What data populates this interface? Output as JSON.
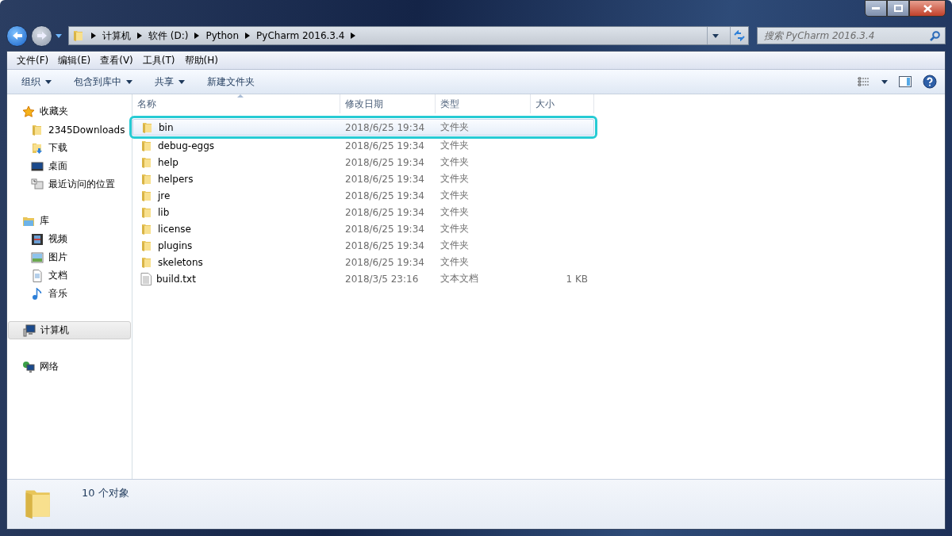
{
  "address_bar": {
    "crumbs": [
      "计算机",
      "软件 (D:)",
      "Python",
      "PyCharm 2016.3.4"
    ]
  },
  "search": {
    "placeholder": "搜索 PyCharm 2016.3.4"
  },
  "menu": [
    "文件(F)",
    "编辑(E)",
    "查看(V)",
    "工具(T)",
    "帮助(H)"
  ],
  "toolbar": [
    {
      "label": "组织",
      "dropdown": true
    },
    {
      "label": "包含到库中",
      "dropdown": true
    },
    {
      "label": "共享",
      "dropdown": true
    },
    {
      "label": "新建文件夹",
      "dropdown": false
    }
  ],
  "sidebar": {
    "groups": [
      {
        "label": "收藏夹",
        "kind": "star",
        "selected": false,
        "children": [
          {
            "label": "2345Downloads",
            "kind": "folder"
          },
          {
            "label": "下载",
            "kind": "download"
          },
          {
            "label": "桌面",
            "kind": "desktop"
          },
          {
            "label": "最近访问的位置",
            "kind": "recent"
          }
        ]
      },
      {
        "label": "库",
        "kind": "library",
        "selected": false,
        "children": [
          {
            "label": "视频",
            "kind": "video"
          },
          {
            "label": "图片",
            "kind": "picture"
          },
          {
            "label": "文档",
            "kind": "document"
          },
          {
            "label": "音乐",
            "kind": "music"
          }
        ]
      },
      {
        "label": "计算机",
        "kind": "computer",
        "selected": true
      },
      {
        "label": "网络",
        "kind": "network",
        "selected": false
      }
    ]
  },
  "table": {
    "columns": [
      "名称",
      "修改日期",
      "类型",
      "大小"
    ],
    "rows": [
      {
        "kind": "folder",
        "name": "bin",
        "date": "2018/6/25 19:34",
        "type": "文件夹",
        "selected": true
      },
      {
        "kind": "folder",
        "name": "debug-eggs",
        "date": "2018/6/25 19:34",
        "type": "文件夹",
        "selected": false
      },
      {
        "kind": "folder",
        "name": "help",
        "date": "2018/6/25 19:34",
        "type": "文件夹",
        "selected": false
      },
      {
        "kind": "folder",
        "name": "helpers",
        "date": "2018/6/25 19:34",
        "type": "文件夹",
        "selected": false
      },
      {
        "kind": "folder",
        "name": "jre",
        "date": "2018/6/25 19:34",
        "type": "文件夹",
        "selected": false
      },
      {
        "kind": "folder",
        "name": "lib",
        "date": "2018/6/25 19:34",
        "type": "文件夹",
        "selected": false
      },
      {
        "kind": "folder",
        "name": "license",
        "date": "2018/6/25 19:34",
        "type": "文件夹",
        "selected": false
      },
      {
        "kind": "folder",
        "name": "plugins",
        "date": "2018/6/25 19:34",
        "type": "文件夹",
        "selected": false
      },
      {
        "kind": "folder",
        "name": "skeletons",
        "date": "2018/6/25 19:34",
        "type": "文件夹",
        "selected": false
      },
      {
        "kind": "text",
        "name": "build.txt",
        "date": "2018/3/5 23:16",
        "type": "文本文档",
        "size": "1 KB",
        "selected": false
      }
    ]
  },
  "status_bar": {
    "text": "10 个对象"
  }
}
